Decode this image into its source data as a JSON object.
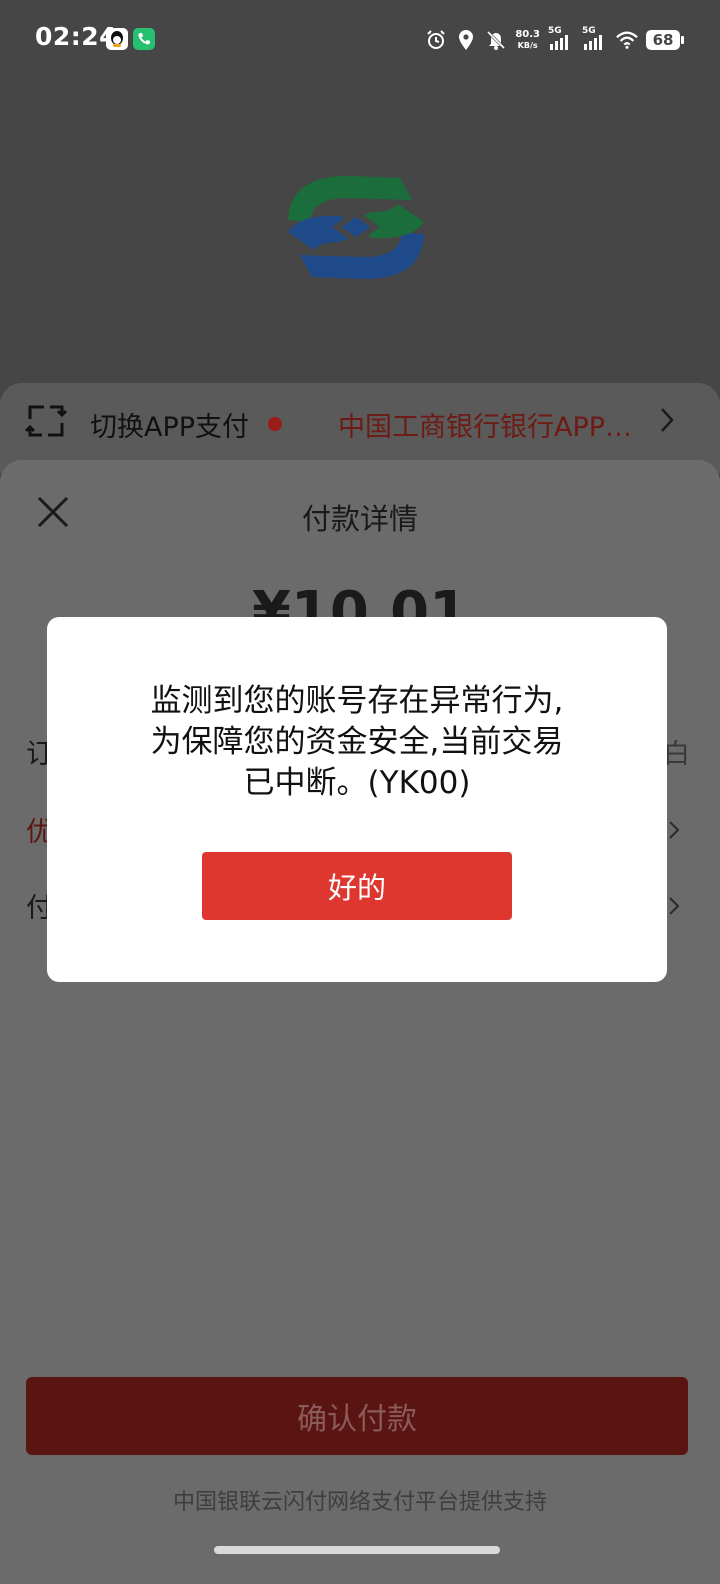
{
  "status_bar": {
    "time": "02:24",
    "net_speed_value": "80.3",
    "net_speed_unit": "KB/s",
    "sim1": "5G",
    "sim2": "5G",
    "battery": "68",
    "icons": [
      "qq-icon",
      "phone-app-icon",
      "alarm-icon",
      "location-icon",
      "mute-icon",
      "signal-icon",
      "wifi-icon",
      "battery-icon"
    ]
  },
  "switch_bar": {
    "label": "切换APP支付",
    "bank": "中国工商银行银行APP…"
  },
  "sheet": {
    "title": "付款详情",
    "amount": "¥10.01",
    "row_order": "订",
    "row_order_right": "白",
    "row_discount": "优",
    "row_method": "付",
    "confirm_label": "确认付款",
    "footer": "中国银联云闪付网络支付平台提供支持"
  },
  "dialog": {
    "line1": "监测到您的账号存在异常行为,",
    "line2": "为保障您的资金安全,当前交易",
    "line3": "已中断。(YK00)",
    "ok_label": "好的"
  },
  "colors": {
    "accent_red": "#dd3730",
    "overlay_dark": "#464646",
    "bank_green": "#1e7a3e",
    "bank_blue": "#1f4a8a"
  }
}
